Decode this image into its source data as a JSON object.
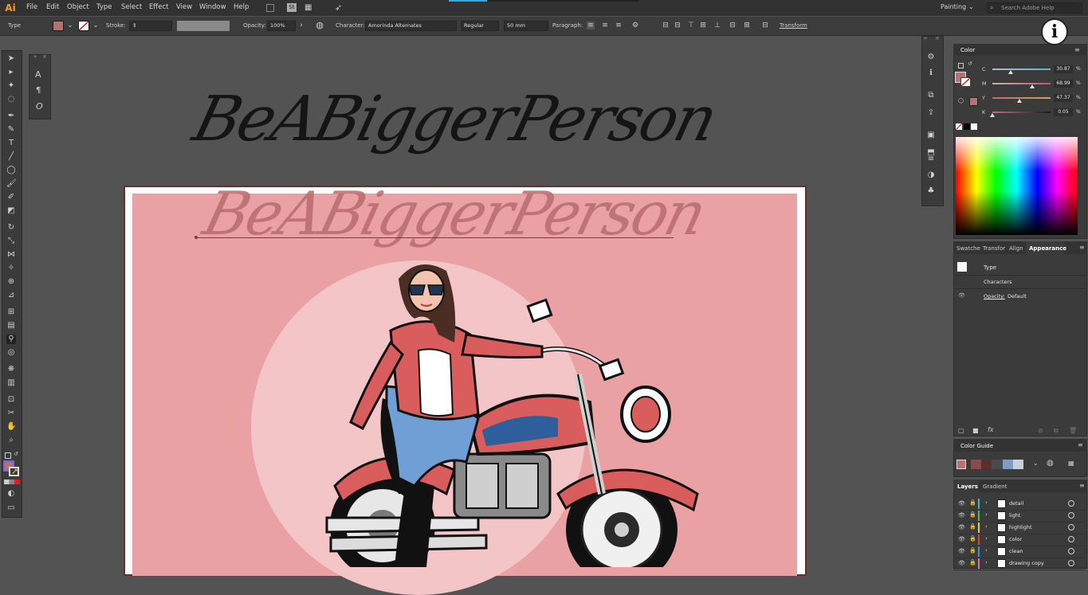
{
  "app": {
    "logo": "Ai",
    "workspace": "Painting",
    "search_placeholder": "Search Adobe Help"
  },
  "menu": [
    "File",
    "Edit",
    "Object",
    "Type",
    "Select",
    "Effect",
    "View",
    "Window",
    "Help"
  ],
  "control_bar": {
    "selection_type": "Type",
    "fill_color": "#b97070",
    "stroke_label": "Stroke:",
    "opacity_label": "Opacity:",
    "opacity_value": "100%",
    "character_label": "Character:",
    "font_family": "Amorinda Alternates",
    "font_style": "Regular",
    "font_size": "50 mm",
    "paragraph_label": "Paragraph:",
    "transform_label": "Transform"
  },
  "canvas": {
    "heading_text": "BeABiggerPerson",
    "ghost_text": "BeABiggerPerson",
    "artboard_bg": "#e9a1a3",
    "circle_color": "#f3c5c7"
  },
  "color_panel": {
    "title": "Color",
    "sliders": [
      {
        "label": "C",
        "value": "30.87",
        "unit": "%",
        "fraction": 0.31,
        "gradient": "linear-gradient(90deg,#b8b8b8,#4fb9d8)"
      },
      {
        "label": "M",
        "value": "68.99",
        "unit": "%",
        "fraction": 0.69,
        "gradient": "linear-gradient(90deg,#c4b3a5,#b35c7d)"
      },
      {
        "label": "Y",
        "value": "47.37",
        "unit": "%",
        "fraction": 0.47,
        "gradient": "linear-gradient(90deg,#c66,#c7a84a)"
      },
      {
        "label": "K",
        "value": "0.05",
        "unit": "%",
        "fraction": 0.0,
        "gradient": "linear-gradient(90deg,#c07272,#1a1a1a)"
      }
    ],
    "current_color": "#b97070"
  },
  "appearance_panel": {
    "tabs": [
      "Swatche",
      "Transfor",
      "Align",
      "Appearance"
    ],
    "active_tab": "Appearance",
    "header": "Type",
    "characters": "Characters",
    "opacity_label": "Opacity:",
    "opacity_value": "Default"
  },
  "color_guide": {
    "title": "Color Guide",
    "swatches": [
      "#b97070",
      "#8a4a48",
      "#5b2f2e",
      "#4a4a4a",
      "#7f9cc9",
      "#c7d1dc"
    ]
  },
  "layers_panel": {
    "tabs": [
      "Layers",
      "Gradient"
    ],
    "active_tab": "Layers",
    "layers": [
      {
        "name": "detail",
        "color": "#39b6c5"
      },
      {
        "name": "light",
        "color": "#4fbf4f"
      },
      {
        "name": "highlight",
        "color": "#e0d044"
      },
      {
        "name": "color",
        "color": "#e04040"
      },
      {
        "name": "clean",
        "color": "#3f8fe0"
      },
      {
        "name": "drawing copy",
        "color": "#e06fb0"
      }
    ]
  },
  "overlay": {
    "info_symbol": "i"
  }
}
